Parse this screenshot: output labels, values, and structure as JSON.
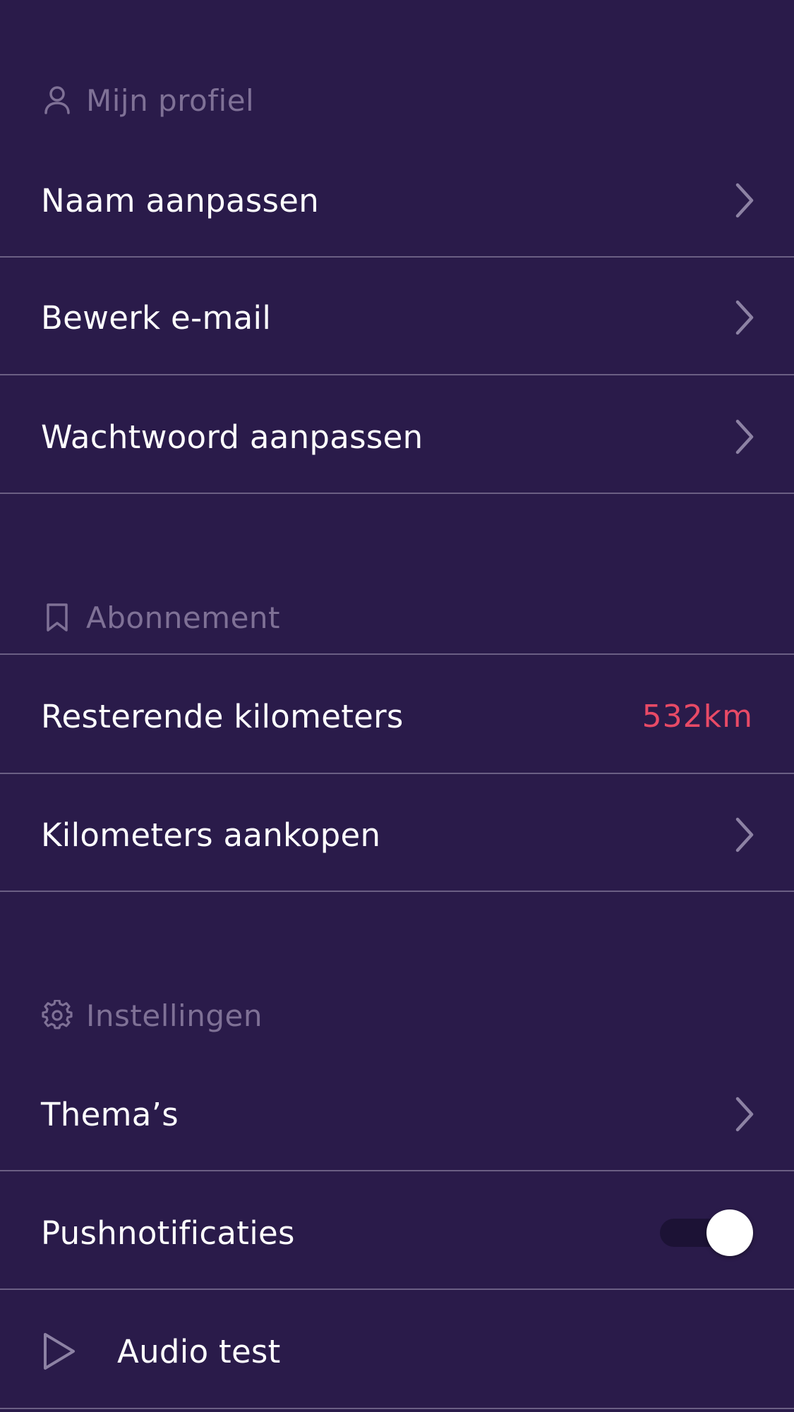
{
  "profile_section": {
    "title": "Mijn profiel",
    "icon": "user-icon",
    "items": [
      {
        "label": "Naam aanpassen"
      },
      {
        "label": "Bewerk e-mail"
      },
      {
        "label": "Wachtwoord aanpassen"
      }
    ]
  },
  "subscription_section": {
    "title": "Abonnement",
    "icon": "bookmark-icon",
    "remaining_label": "Resterende kilometers",
    "remaining_value": "532km",
    "buy_label": "Kilometers aankopen"
  },
  "settings_section": {
    "title": "Instellingen",
    "icon": "gear-icon",
    "themes_label": "Thema’s",
    "push_label": "Pushnotificaties",
    "push_enabled": true,
    "audio_label": "Audio test"
  },
  "colors": {
    "background": "#2a1b4a",
    "muted_text": "#7f7196",
    "divider": "#6b5f84",
    "accent_red": "#e84a66"
  }
}
